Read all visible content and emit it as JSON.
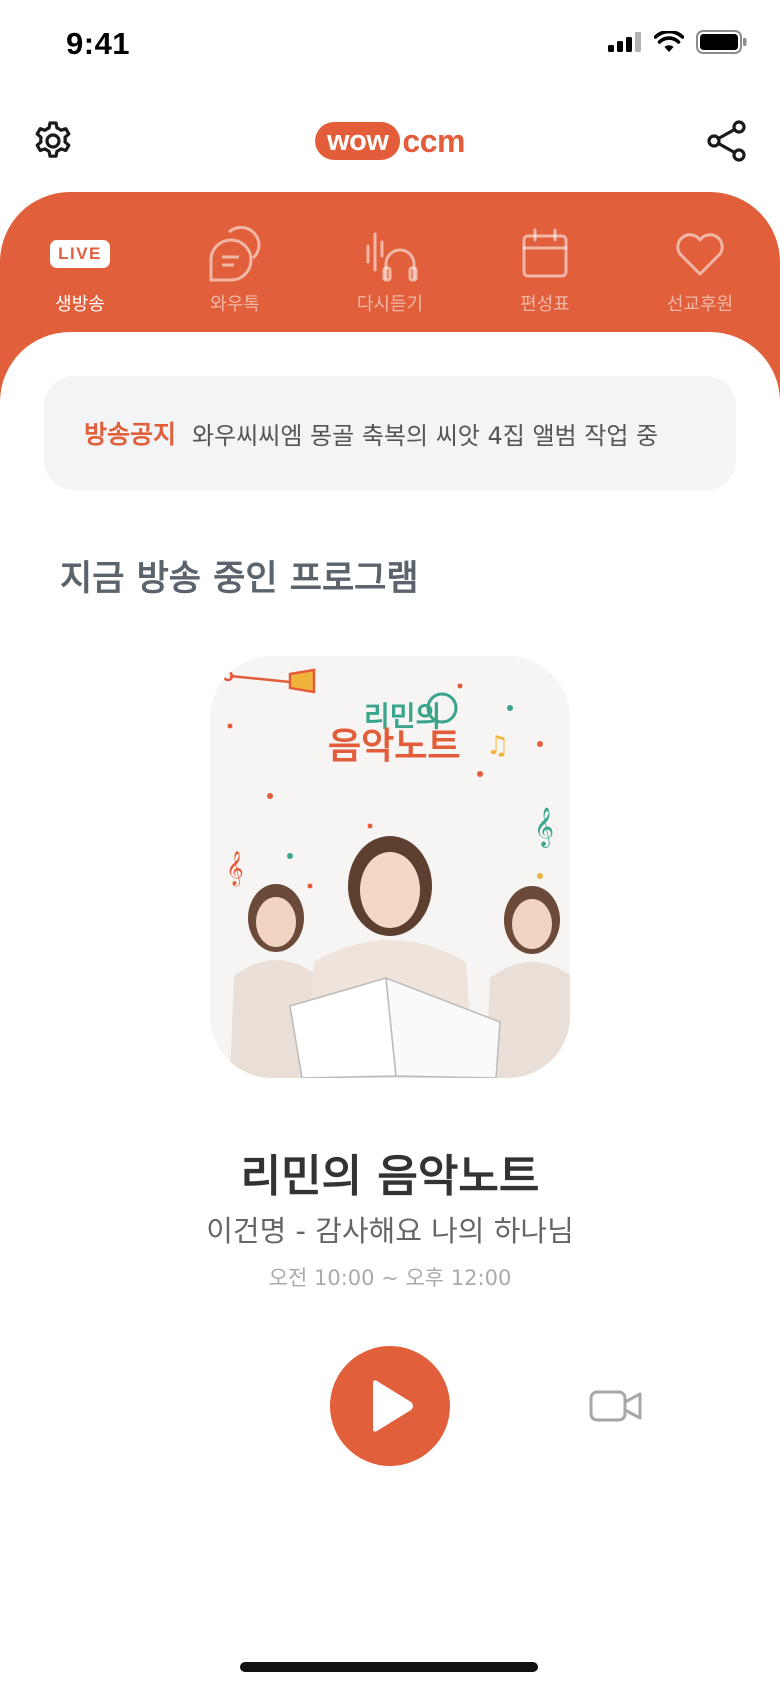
{
  "status": {
    "time": "9:41"
  },
  "header": {
    "logo_wow": "wow",
    "logo_ccm": "ccm",
    "settings_icon": "gear-icon",
    "share_icon": "share-icon"
  },
  "tabs": [
    {
      "label": "생방송",
      "badge": "LIVE",
      "icon": "live-icon",
      "active": true
    },
    {
      "label": "와우톡",
      "icon": "chat-bubbles-icon",
      "active": false
    },
    {
      "label": "다시듣기",
      "icon": "headphones-icon",
      "active": false
    },
    {
      "label": "편성표",
      "icon": "calendar-icon",
      "active": false
    },
    {
      "label": "선교후원",
      "icon": "heart-icon",
      "active": false
    }
  ],
  "notice": {
    "label": "방송공지",
    "text": "와우씨씨엠 몽골 축복의 씨앗 4집 앨범 작업 중"
  },
  "section_title": "지금 방송 중인 프로그램",
  "program": {
    "album_art_title_top": "리민의",
    "album_art_title_bottom": "음악노트",
    "title": "리민의 음악노트",
    "song": "이건명 - 감사해요 나의 하나님",
    "time": "오전 10:00 ~ 오후 12:00"
  },
  "controls": {
    "play_icon": "play-icon",
    "video_icon": "video-camera-icon"
  },
  "colors": {
    "accent": "#e15f3b",
    "notice_bg": "#f3f4f6"
  }
}
